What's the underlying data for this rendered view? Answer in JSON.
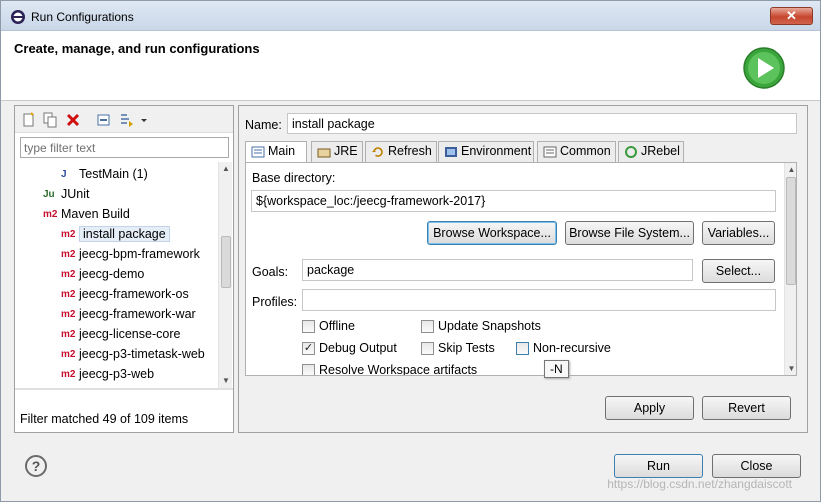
{
  "window": {
    "title": "Run Configurations",
    "close_label": "✕"
  },
  "banner": {
    "title": "Create, manage, and run configurations"
  },
  "left": {
    "filter_placeholder": "type filter text",
    "tree": [
      {
        "label": "TestMain (1)",
        "icon": "J"
      },
      {
        "label": "JUnit",
        "icon": "Ju"
      },
      {
        "label": "Maven Build",
        "icon": "m2"
      },
      {
        "label": "install package",
        "icon": "m2"
      },
      {
        "label": "jeecg-bpm-framework",
        "icon": "m2"
      },
      {
        "label": "jeecg-demo",
        "icon": "m2"
      },
      {
        "label": "jeecg-framework-os",
        "icon": "m2"
      },
      {
        "label": "jeecg-framework-war",
        "icon": "m2"
      },
      {
        "label": "jeecg-license-core",
        "icon": "m2"
      },
      {
        "label": "jeecg-p3-timetask-web",
        "icon": "m2"
      },
      {
        "label": "jeecg-p3-web",
        "icon": "m2"
      }
    ],
    "status": "Filter matched 49 of 109 items"
  },
  "right": {
    "name_label": "Name:",
    "name_value": "install package",
    "tabs": [
      "Main",
      "JRE",
      "Refresh",
      "Environment",
      "Common",
      "JRebel"
    ],
    "main": {
      "base_dir_label": "Base directory:",
      "base_dir_value": "${workspace_loc:/jeecg-framework-2017}",
      "browse_workspace": "Browse Workspace...",
      "browse_fs": "Browse File System...",
      "variables": "Variables...",
      "goals_label": "Goals:",
      "goals_value": "package",
      "select": "Select...",
      "profiles_label": "Profiles:",
      "profiles_value": "",
      "offline": "Offline",
      "update_snapshots": "Update Snapshots",
      "debug_output": "Debug Output",
      "skip_tests": "Skip Tests",
      "non_recursive": "Non-recursive",
      "resolve_workspace": "Resolve Workspace artifacts",
      "tooltip": "-N"
    },
    "apply": "Apply",
    "revert": "Revert"
  },
  "footer": {
    "help": "?",
    "run": "Run",
    "close": "Close",
    "watermark": "https://blog.csdn.net/zhangdaiscott"
  }
}
